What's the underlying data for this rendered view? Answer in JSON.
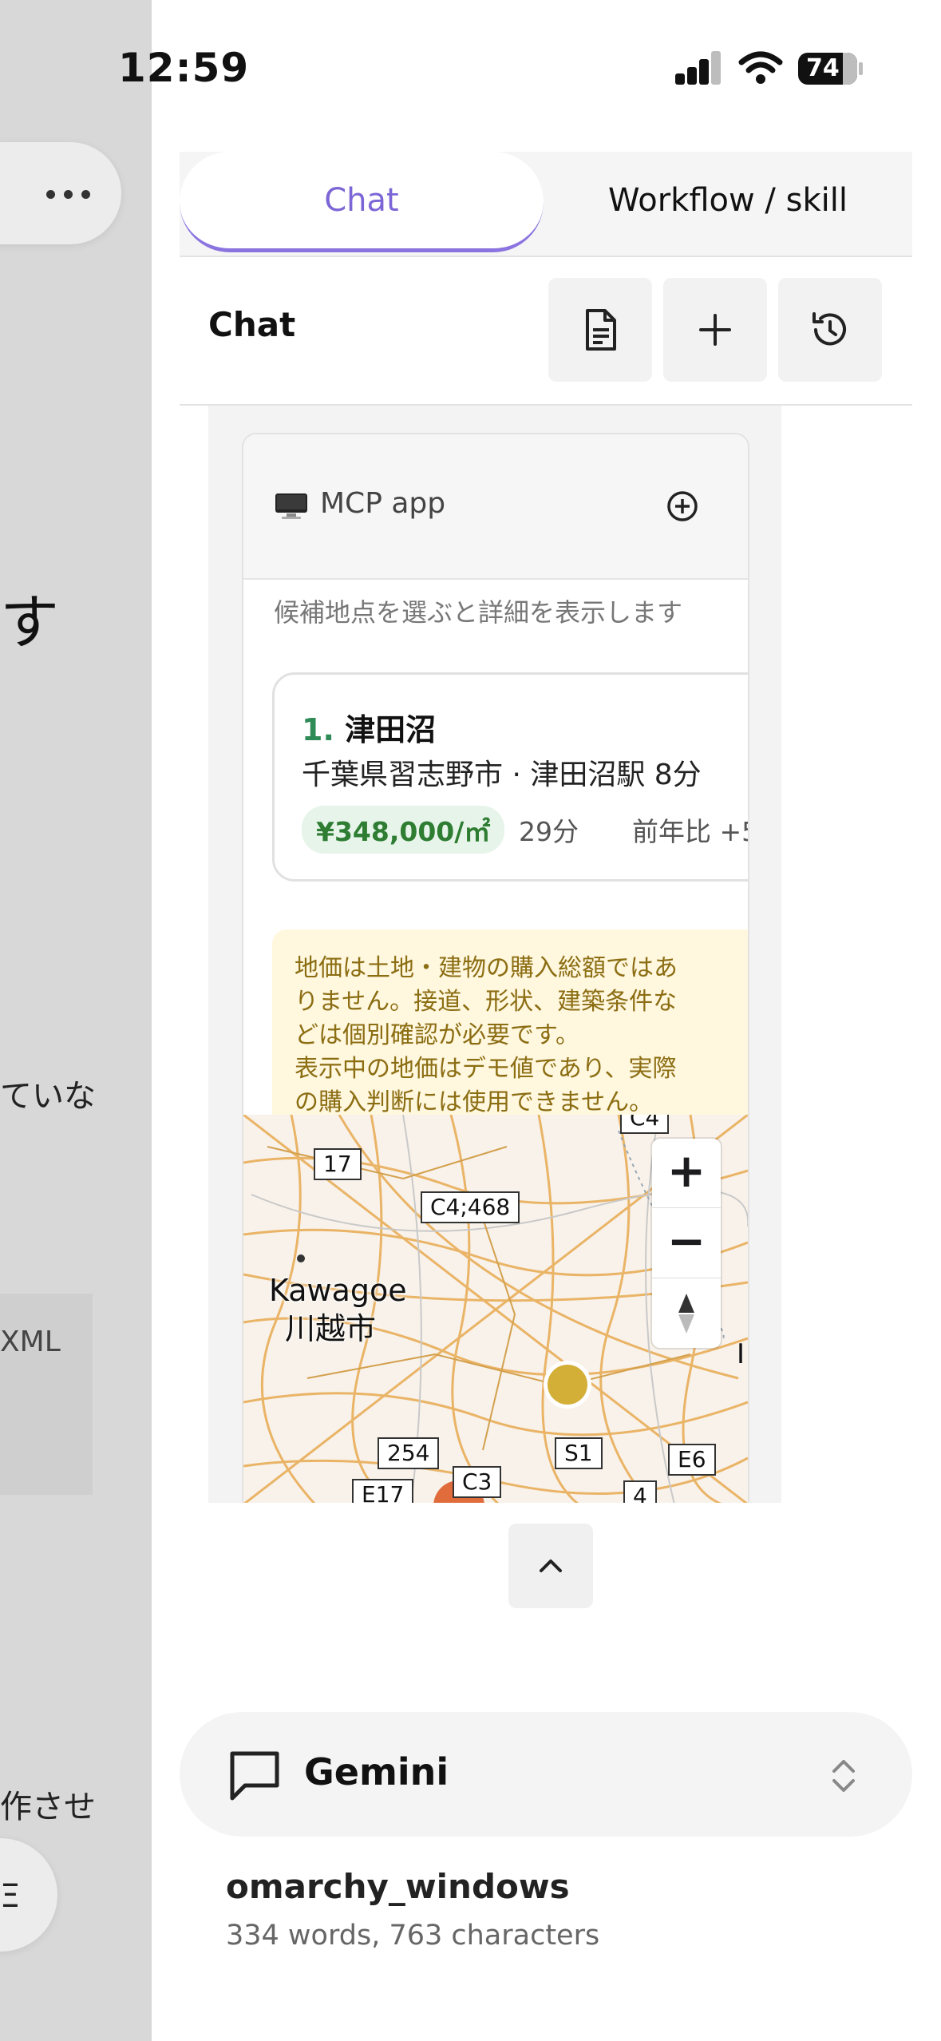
{
  "status_bar": {
    "time": "12:59",
    "battery": "74"
  },
  "background_sheet": {
    "partial_text_1": "す",
    "partial_text_2": "ていな",
    "partial_text_3": "XML",
    "partial_text_4": "作させ",
    "partial_text_5": "Ξ"
  },
  "tabs": {
    "chat": "Chat",
    "workflow": "Workflow / skill"
  },
  "chat_header": {
    "title": "Chat",
    "doc_icon": "document-icon",
    "add_icon": "plus-icon",
    "history_icon": "history-icon"
  },
  "mcp_app": {
    "label": "MCP app",
    "hint": "候補地点を選ぶと詳細を表示します",
    "place": {
      "number": "1.",
      "name": "津田沼",
      "subtitle": "千葉県習志野市 · 津田沼駅 8分",
      "price": "¥348,000/㎡",
      "commute": "29分",
      "yoy": "前年比 +5"
    },
    "notice_lines": [
      "地価は土地・建物の購入総額ではあ",
      "りません。接道、形状、建築条件な",
      "どは個別確認が必要です。",
      "表示中の地価はデモ値であり、実際",
      "の購入判断には使用できません。"
    ],
    "map": {
      "city_en": "Kawagoe",
      "city_ja": "川越市",
      "shields": [
        "17",
        "C4;468",
        "C4",
        "254",
        "S1",
        "E6",
        "E17",
        "C3",
        "4"
      ],
      "marker_colors": {
        "gold": "#d4af37",
        "orange": "#e06c3c"
      },
      "zoom_in": "+",
      "zoom_out": "−",
      "edge_letter": "I"
    }
  },
  "model_picker": {
    "name": "Gemini"
  },
  "document": {
    "title": "omarchy_windows",
    "stats": "334 words, 763 characters"
  }
}
